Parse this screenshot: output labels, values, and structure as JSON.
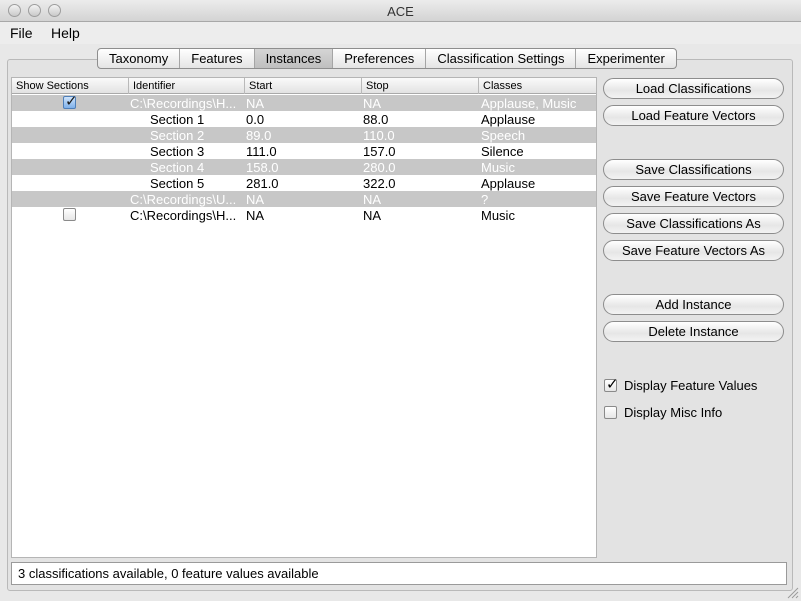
{
  "window": {
    "title": "ACE"
  },
  "menu": [
    "File",
    "Help"
  ],
  "tabs": [
    {
      "label": "Taxonomy",
      "active": false
    },
    {
      "label": "Features",
      "active": false
    },
    {
      "label": "Instances",
      "active": true
    },
    {
      "label": "Preferences",
      "active": false
    },
    {
      "label": "Classification Settings",
      "active": false
    },
    {
      "label": "Experimenter",
      "active": false
    }
  ],
  "table": {
    "headers": [
      "Show Sections",
      "Identifier",
      "Start",
      "Stop",
      "Classes"
    ],
    "rows": [
      {
        "checkbox": "checked",
        "identifier": "C:\\Recordings\\H...",
        "start": "NA",
        "stop": "NA",
        "classes": "Applause, Music",
        "alt": true
      },
      {
        "checkbox": "",
        "identifier": "Section 1",
        "start": "0.0",
        "stop": "88.0",
        "classes": "Applause",
        "alt": false
      },
      {
        "checkbox": "",
        "identifier": "Section 2",
        "start": "89.0",
        "stop": "110.0",
        "classes": "Speech",
        "alt": true
      },
      {
        "checkbox": "",
        "identifier": "Section 3",
        "start": "111.0",
        "stop": "157.0",
        "classes": "Silence",
        "alt": false
      },
      {
        "checkbox": "",
        "identifier": "Section 4",
        "start": "158.0",
        "stop": "280.0",
        "classes": "Music",
        "alt": true
      },
      {
        "checkbox": "",
        "identifier": "Section 5",
        "start": "281.0",
        "stop": "322.0",
        "classes": "Applause",
        "alt": false
      },
      {
        "checkbox": "",
        "identifier": "C:\\Recordings\\U...",
        "start": "NA",
        "stop": "NA",
        "classes": "?",
        "alt": true
      },
      {
        "checkbox": "unchecked",
        "identifier": "C:\\Recordings\\H...",
        "start": "NA",
        "stop": "NA",
        "classes": "Music",
        "alt": false
      }
    ]
  },
  "buttons": {
    "load_classifications": "Load Classifications",
    "load_feature_vectors": "Load Feature Vectors",
    "save_classifications": "Save Classifications",
    "save_feature_vectors": "Save Feature Vectors",
    "save_classifications_as": "Save Classifications As",
    "save_feature_vectors_as": "Save Feature Vectors As",
    "add_instance": "Add Instance",
    "delete_instance": "Delete Instance"
  },
  "options": {
    "display_feature_values": {
      "label": "Display Feature Values",
      "checked": true
    },
    "display_misc_info": {
      "label": "Display Misc Info",
      "checked": false
    }
  },
  "status": "3 classifications available, 0 feature values available"
}
